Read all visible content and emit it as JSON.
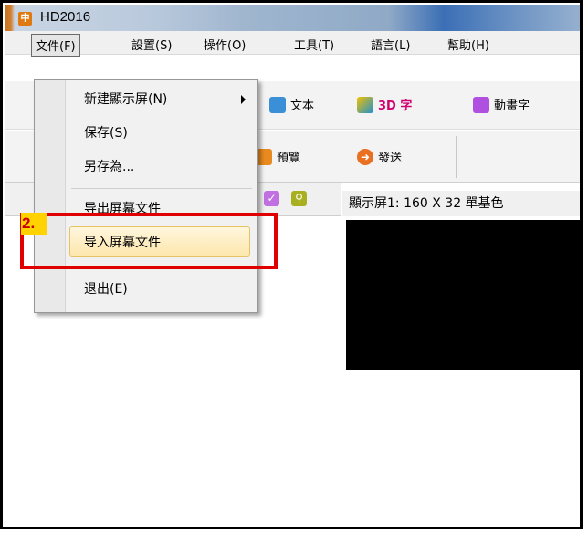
{
  "window": {
    "title": "HD2016",
    "app_icon": "app-logo-icon"
  },
  "menubar": [
    {
      "label": "文件(F)",
      "active": true
    },
    {
      "label": "設置(S)"
    },
    {
      "label": "操作(O)"
    },
    {
      "label": "工具(T)"
    },
    {
      "label": "語言(L)"
    },
    {
      "label": "幫助(H)"
    }
  ],
  "toolbar": {
    "text_label": "文本",
    "text3d_label": "3D 字",
    "anim_label": "動畫字",
    "preview_label": "預覽",
    "send_label": "發送"
  },
  "file_menu": {
    "new_screen": "新建顯示屏(N)",
    "save": "保存(S)",
    "save_as": "另存為...",
    "export_screen": "导出屏幕文件",
    "import_screen": "导入屏幕文件",
    "exit": "退出(E)"
  },
  "annotation": {
    "step": "2."
  },
  "screen": {
    "header": "顯示屏1: 160 X 32 單基色"
  },
  "colors": {
    "highlight_red": "#e00000",
    "badge_yellow": "#ffd200",
    "check_purple": "#c070e0",
    "search_olive": "#a8b020"
  }
}
